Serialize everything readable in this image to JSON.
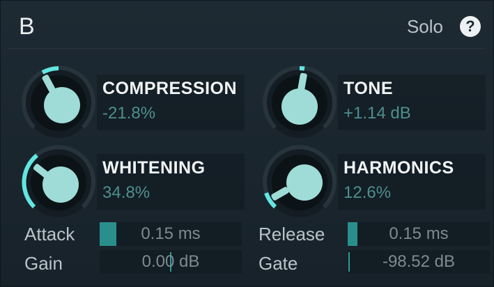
{
  "header": {
    "title": "B",
    "solo_label": "Solo",
    "help_glyph": "?"
  },
  "modules": {
    "compression": {
      "name": "COMPRESSION",
      "value": "-21.8%",
      "level": -0.218
    },
    "tone": {
      "name": "TONE",
      "value": "+1.14 dB",
      "level": 0.1
    },
    "whitening": {
      "name": "WHITENING",
      "value": "34.8%",
      "level": 0.348
    },
    "harmonics": {
      "name": "HARMONICS",
      "value": "12.6%",
      "level": 0.126
    }
  },
  "params": {
    "attack": {
      "label": "Attack",
      "value": "0.15 ms",
      "fill": 0.12
    },
    "release": {
      "label": "Release",
      "value": "0.15 ms",
      "fill": 0.07
    },
    "gain": {
      "label": "Gain",
      "value": "0.00 dB",
      "center": 0.5
    },
    "gate": {
      "label": "Gate",
      "value": "-98.52 dB",
      "marker": 0.01
    }
  },
  "colors": {
    "accent": "#62e6e1",
    "knob_cap": "#9fdcd8",
    "background": "#1a252d"
  }
}
